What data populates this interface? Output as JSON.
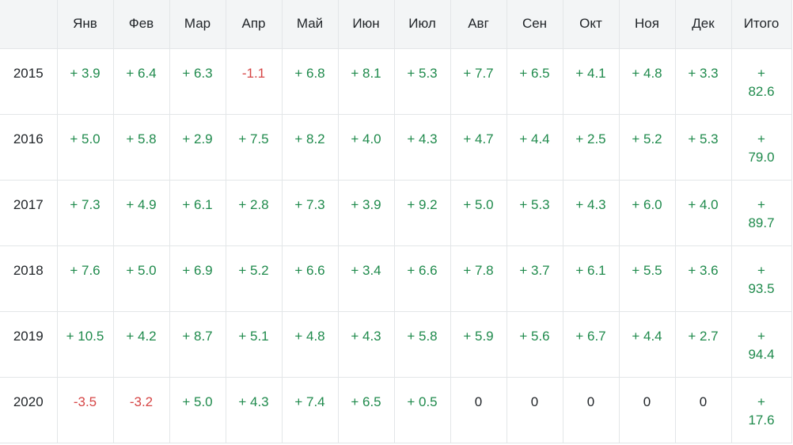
{
  "header": {
    "year": "",
    "months": [
      "Янв",
      "Фев",
      "Мар",
      "Апр",
      "Май",
      "Июн",
      "Июл",
      "Авг",
      "Сен",
      "Окт",
      "Ноя",
      "Дек"
    ],
    "total": "Итого"
  },
  "rows": [
    {
      "year": "2015",
      "months": [
        "+ 3.9",
        "+ 6.4",
        "+ 6.3",
        "-1.1",
        "+ 6.8",
        "+ 8.1",
        "+ 5.3",
        "+ 7.7",
        "+ 6.5",
        "+ 4.1",
        "+ 4.8",
        "+ 3.3"
      ],
      "total": "+\n82.6"
    },
    {
      "year": "2016",
      "months": [
        "+ 5.0",
        "+ 5.8",
        "+ 2.9",
        "+ 7.5",
        "+ 8.2",
        "+ 4.0",
        "+ 4.3",
        "+ 4.7",
        "+ 4.4",
        "+ 2.5",
        "+ 5.2",
        "+ 5.3"
      ],
      "total": "+\n79.0"
    },
    {
      "year": "2017",
      "months": [
        "+ 7.3",
        "+ 4.9",
        "+ 6.1",
        "+ 2.8",
        "+ 7.3",
        "+ 3.9",
        "+ 9.2",
        "+ 5.0",
        "+ 5.3",
        "+ 4.3",
        "+ 6.0",
        "+ 4.0"
      ],
      "total": "+\n89.7"
    },
    {
      "year": "2018",
      "months": [
        "+ 7.6",
        "+ 5.0",
        "+ 6.9",
        "+ 5.2",
        "+ 6.6",
        "+ 3.4",
        "+ 6.6",
        "+ 7.8",
        "+ 3.7",
        "+ 6.1",
        "+ 5.5",
        "+ 3.6"
      ],
      "total": "+\n93.5"
    },
    {
      "year": "2019",
      "months": [
        "+ 10.5",
        "+ 4.2",
        "+ 8.7",
        "+ 5.1",
        "+ 4.8",
        "+ 4.3",
        "+ 5.8",
        "+ 5.9",
        "+ 5.6",
        "+ 6.7",
        "+ 4.4",
        "+ 2.7"
      ],
      "total": "+\n94.4"
    },
    {
      "year": "2020",
      "months": [
        "-3.5",
        "-3.2",
        "+ 5.0",
        "+ 4.3",
        "+ 7.4",
        "+ 6.5",
        "+ 0.5",
        "0",
        "0",
        "0",
        "0",
        "0"
      ],
      "total": "+\n17.6"
    }
  ],
  "colors": {
    "positive": "#1f8a4c",
    "negative": "#d64545",
    "neutral": "#212529",
    "header_bg": "#f3f5f6",
    "border": "#e3e6e8"
  }
}
